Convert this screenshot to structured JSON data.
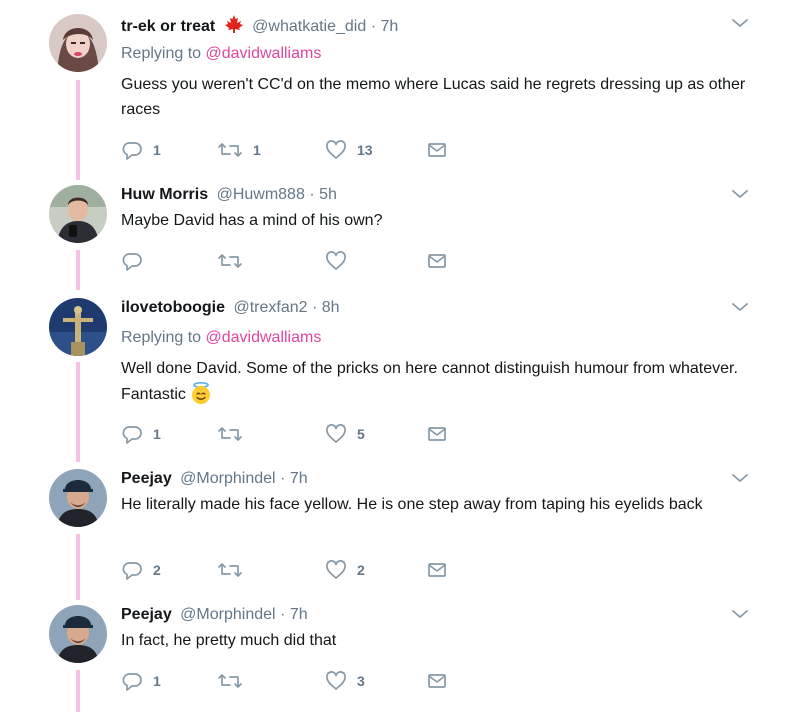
{
  "tweets": [
    {
      "name": "tr-ek or treat",
      "handle": "@whatkatie_did",
      "separator": "·",
      "time": "7h",
      "replying_label": "Replying to",
      "replying_to": "@davidwalliams",
      "text": "Guess you weren't CC'd on the memo where Lucas said he regrets dressing up as other races",
      "replies": "1",
      "retweets": "1",
      "likes": "13",
      "icons": [
        "maple-leaf-icon"
      ]
    },
    {
      "name": "Huw Morris",
      "handle": "@Huwm888",
      "separator": "·",
      "time": "5h",
      "text": "Maybe David has a mind of his own?",
      "replies": "",
      "retweets": "",
      "likes": ""
    },
    {
      "name": "ilovetoboogie",
      "handle": "@trexfan2",
      "separator": "·",
      "time": "8h",
      "replying_label": "Replying to",
      "replying_to": "@davidwalliams",
      "text": "Well done David. Some of the pricks on here cannot distinguish humour from whatever. Fantastic",
      "replies": "1",
      "retweets": "",
      "likes": "5",
      "icons": [
        "halo-smile-emoji"
      ]
    },
    {
      "name": "Peejay",
      "handle": "@Morphindel",
      "separator": "·",
      "time": "7h",
      "text": "He literally made his face yellow. He is one step away from taping his eyelids back",
      "replies": "2",
      "retweets": "",
      "likes": "2"
    },
    {
      "name": "Peejay",
      "handle": "@Morphindel",
      "separator": "·",
      "time": "7h",
      "text": "In fact, he pretty much did that",
      "replies": "1",
      "retweets": "",
      "likes": "3"
    }
  ],
  "colors": {
    "thread_line": "#f4c2e3",
    "mention": "#e0479e",
    "secondary_text": "#657786",
    "primary_text": "#14171a"
  }
}
